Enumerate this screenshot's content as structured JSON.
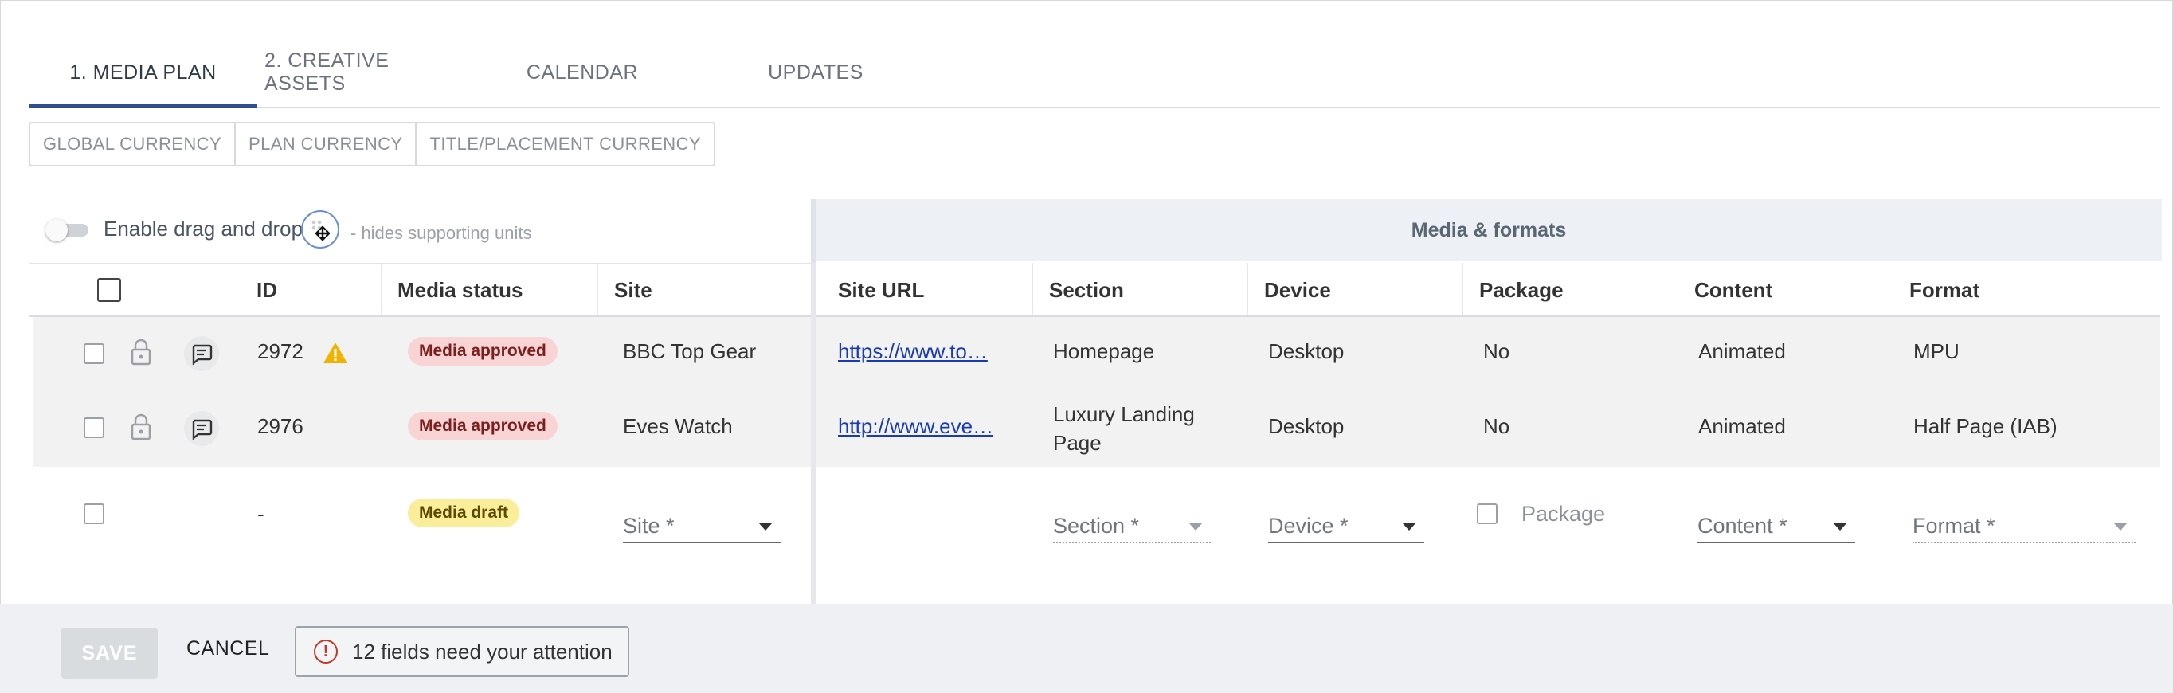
{
  "tabs": [
    {
      "label": "1. MEDIA PLAN",
      "active": true
    },
    {
      "label": "2. CREATIVE ASSETS",
      "active": false
    },
    {
      "label": "CALENDAR",
      "active": false
    },
    {
      "label": "UPDATES",
      "active": false
    }
  ],
  "currency": [
    "GLOBAL CURRENCY",
    "PLAN CURRENCY",
    "TITLE/PLACEMENT CURRENCY"
  ],
  "dnd": {
    "label": "Enable drag and drop",
    "hint": "- hides supporting units",
    "icon": "drag-move-icon"
  },
  "group_header": "Media & formats",
  "columns": {
    "id": "ID",
    "media_status": "Media status",
    "site": "Site",
    "site_url": "Site URL",
    "section": "Section",
    "device": "Device",
    "package": "Package",
    "content": "Content",
    "format": "Format"
  },
  "rows": [
    {
      "id": "2972",
      "warning": true,
      "status": "Media approved",
      "site": "BBC Top Gear",
      "site_url": "https://www.to…",
      "section": "Homepage",
      "device": "Desktop",
      "package": "No",
      "content": "Animated",
      "format": "MPU"
    },
    {
      "id": "2976",
      "warning": false,
      "status": "Media approved",
      "site": "Eves Watch",
      "site_url": "http://www.eve…",
      "section": "Luxury Landing Page",
      "device": "Desktop",
      "package": "No",
      "content": "Animated",
      "format": "Half Page (IAB)"
    }
  ],
  "draft_row": {
    "id": "-",
    "status": "Media draft",
    "site_placeholder": "Site *",
    "section_placeholder": "Section *",
    "device_placeholder": "Device *",
    "package_label": "Package",
    "content_placeholder": "Content *",
    "format_placeholder": "Format *"
  },
  "footer": {
    "save": "SAVE",
    "cancel": "CANCEL",
    "attention": "12 fields need your attention"
  },
  "colors": {
    "accent": "#2f4f8f",
    "approved_bg": "#f8d4d4",
    "draft_bg": "#fbee9a",
    "warning": "#f0b400",
    "error": "#c0392b"
  }
}
